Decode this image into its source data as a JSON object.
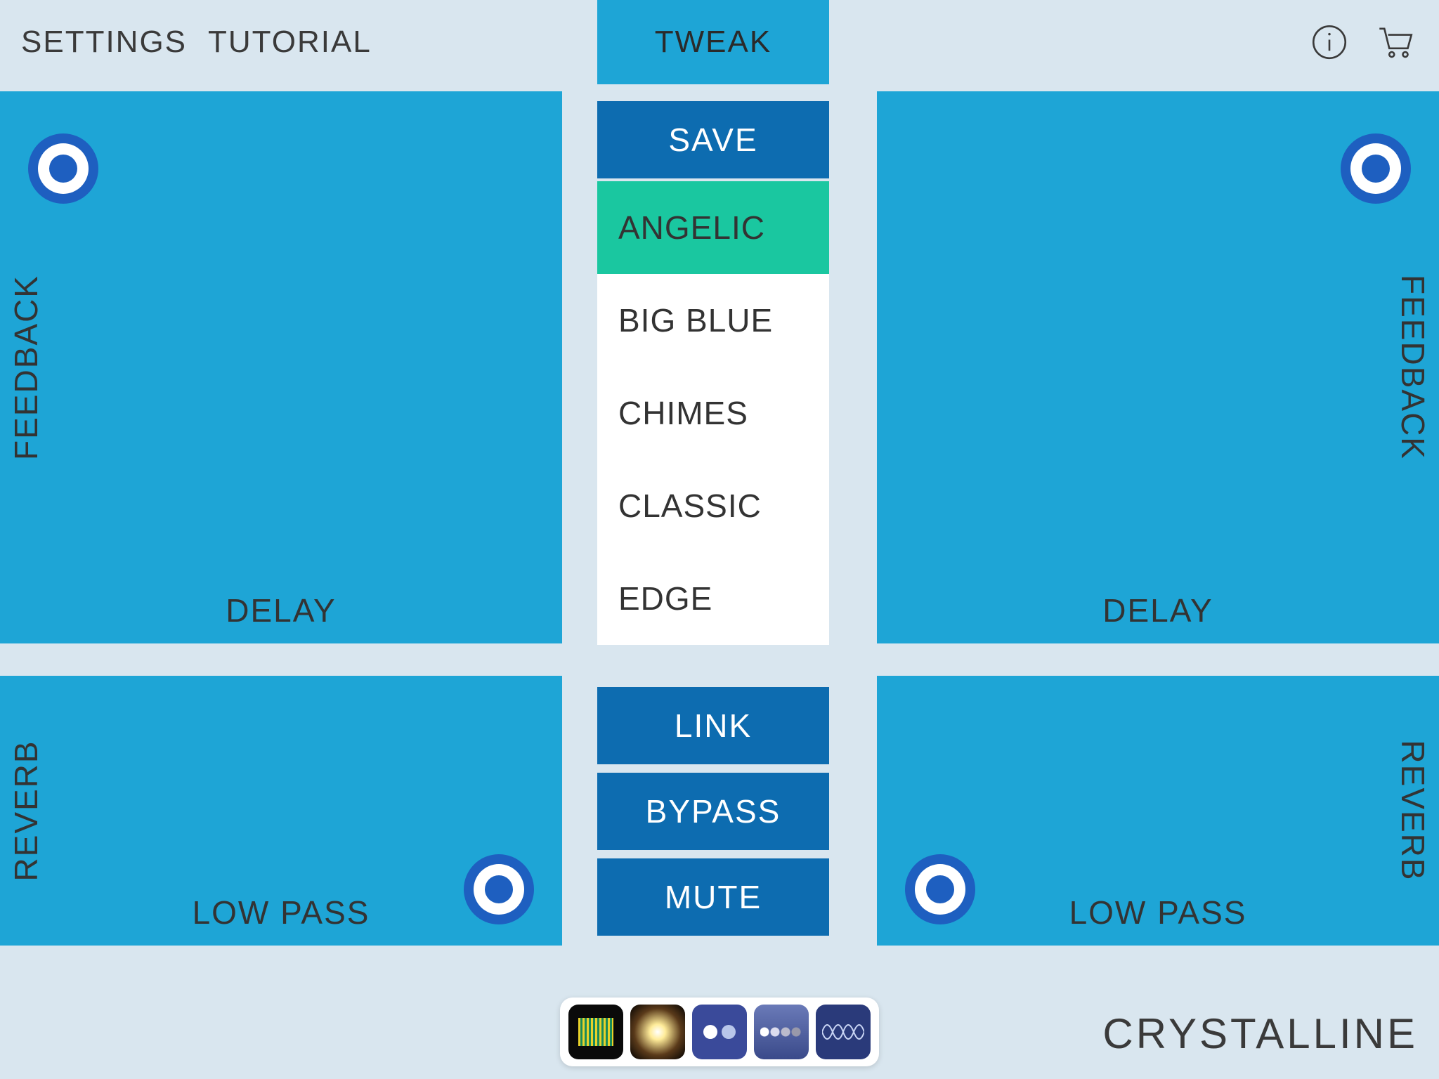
{
  "topbar": {
    "settings_label": "SETTINGS",
    "tutorial_label": "TUTORIAL"
  },
  "center": {
    "tweak_label": "TWEAK",
    "save_label": "SAVE",
    "link_label": "LINK",
    "bypass_label": "BYPASS",
    "mute_label": "MUTE",
    "presets": [
      {
        "label": "ANGELIC",
        "selected": true
      },
      {
        "label": "BIG BLUE",
        "selected": false
      },
      {
        "label": "CHIMES",
        "selected": false
      },
      {
        "label": "CLASSIC",
        "selected": false
      },
      {
        "label": "EDGE",
        "selected": false
      }
    ]
  },
  "pads": {
    "top_left": {
      "xlabel": "DELAY",
      "ylabel": "FEEDBACK"
    },
    "top_right": {
      "xlabel": "DELAY",
      "ylabel": "FEEDBACK"
    },
    "bottom_left": {
      "xlabel": "LOW PASS",
      "ylabel": "REVERB"
    },
    "bottom_right": {
      "xlabel": "LOW PASS",
      "ylabel": "REVERB"
    }
  },
  "brand": "CRYSTALLINE",
  "tray": {
    "apps": [
      "audiobus",
      "sunburst",
      "dots-duo",
      "dots-row",
      "waves"
    ]
  },
  "colors": {
    "bg": "#d9e6ef",
    "pad": "#1ea5d6",
    "button": "#0d6cb0",
    "preset_selected": "#1ac7a0",
    "handle": "#1e5fc0"
  }
}
